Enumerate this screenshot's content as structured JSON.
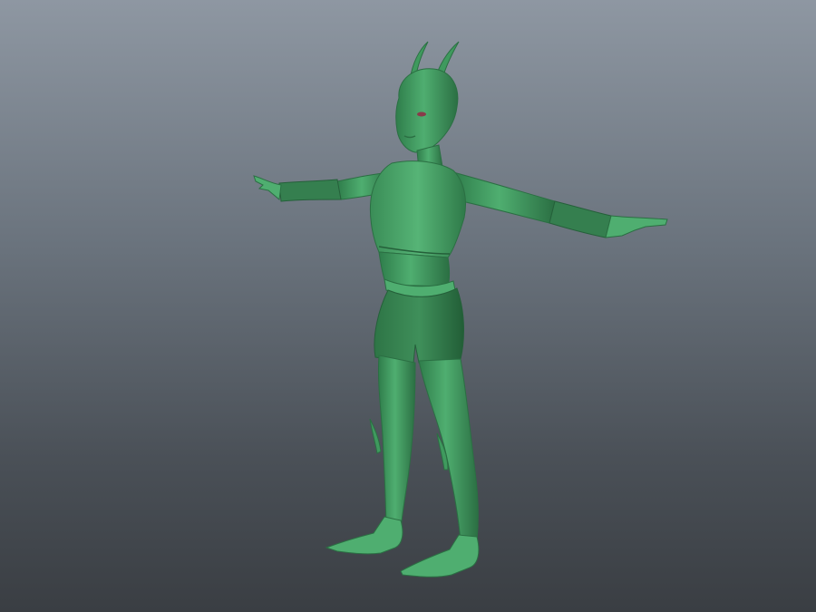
{
  "viewport": {
    "background_top": "#8e97a2",
    "background_bottom": "#3a3e43"
  },
  "model": {
    "icon": "alien-insect-character-model",
    "colors": {
      "skin": "#3f9a5e",
      "skin_light": "#5cb67a",
      "skin_dark": "#2b6f43",
      "clothing": "#357f4f",
      "clothing_dark": "#25603a",
      "eye": "#8a3a4a"
    }
  }
}
